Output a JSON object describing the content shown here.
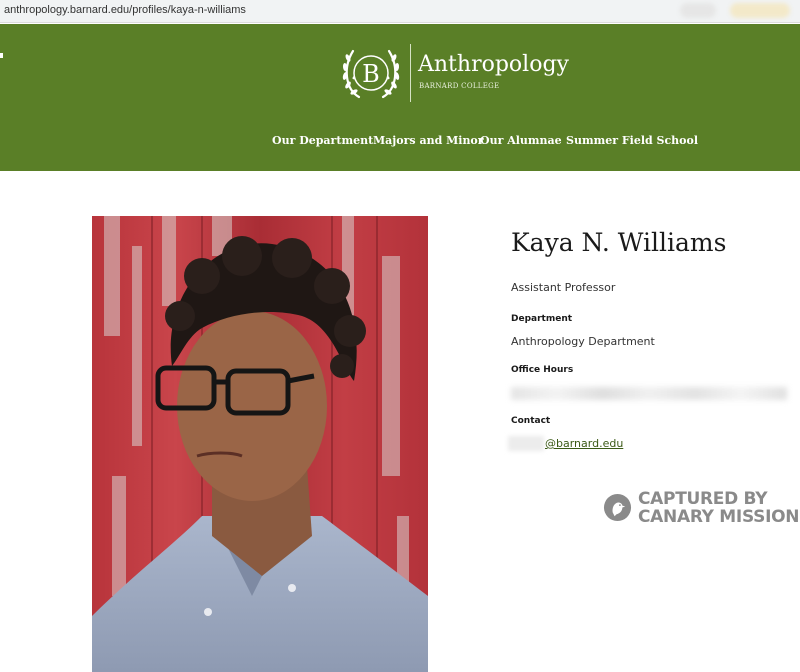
{
  "browser": {
    "url": "anthropology.barnard.edu/profiles/kaya-n-williams"
  },
  "header": {
    "logo_letter": "B",
    "site_title": "Anthropology",
    "site_subtitle": "BARNARD COLLEGE",
    "background_color": "#5a7f27",
    "nav": [
      {
        "label": "Our Department"
      },
      {
        "label": "Majors and Minor"
      },
      {
        "label": "Our Alumnae"
      },
      {
        "label": "Summer Field School"
      }
    ]
  },
  "profile": {
    "name": "Kaya N. Williams",
    "title": "Assistant Professor",
    "department_label": "Department",
    "department_value": "Anthropology Department",
    "office_hours_label": "Office Hours",
    "contact_label": "Contact",
    "email_visible": "@barnard.edu"
  },
  "watermark": {
    "line1": "CAPTURED BY",
    "line2": "CANARY MISSION"
  }
}
